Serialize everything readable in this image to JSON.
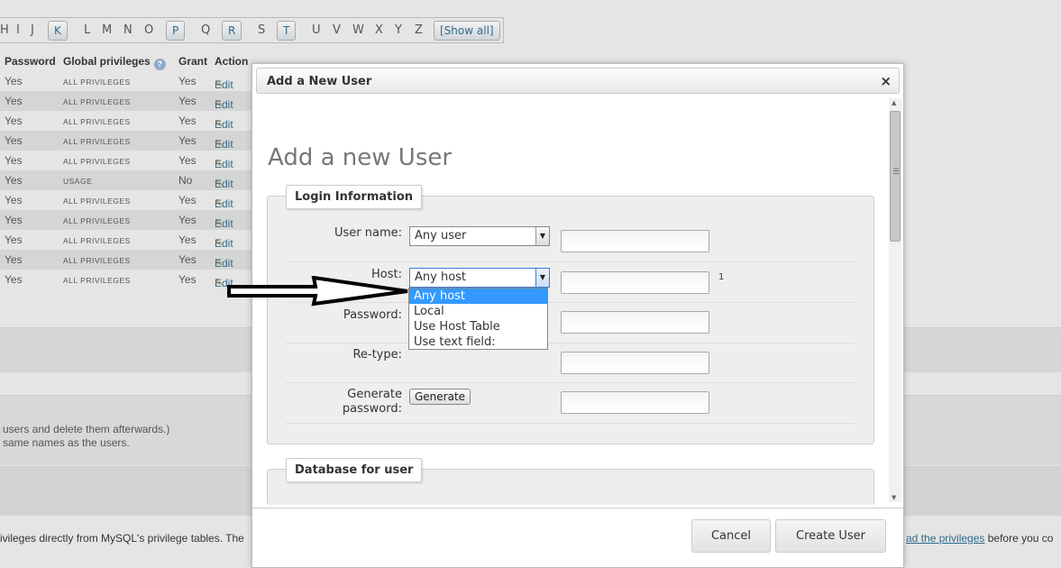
{
  "alphabet": {
    "letters": [
      "H",
      "I",
      "J",
      "K",
      "L",
      "M",
      "N",
      "O",
      "P",
      "Q",
      "R",
      "S",
      "T",
      "U",
      "V",
      "W",
      "X",
      "Y",
      "Z"
    ],
    "show_all": "[Show all]"
  },
  "users_table": {
    "headers": {
      "password": "Password",
      "global_privileges": "Global privileges",
      "grant": "Grant",
      "action": "Action"
    },
    "rows": [
      {
        "password": "Yes",
        "privileges": "ALL PRIVILEGES",
        "grant": "Yes",
        "action": "Edit"
      },
      {
        "password": "Yes",
        "privileges": "ALL PRIVILEGES",
        "grant": "Yes",
        "action": "Edit"
      },
      {
        "password": "Yes",
        "privileges": "ALL PRIVILEGES",
        "grant": "Yes",
        "action": "Edit"
      },
      {
        "password": "Yes",
        "privileges": "ALL PRIVILEGES",
        "grant": "Yes",
        "action": "Edit"
      },
      {
        "password": "Yes",
        "privileges": "ALL PRIVILEGES",
        "grant": "Yes",
        "action": "Edit"
      },
      {
        "password": "Yes",
        "privileges": "USAGE",
        "grant": "No",
        "action": "Edit"
      },
      {
        "password": "Yes",
        "privileges": "ALL PRIVILEGES",
        "grant": "Yes",
        "action": "Edit"
      },
      {
        "password": "Yes",
        "privileges": "ALL PRIVILEGES",
        "grant": "Yes",
        "action": "Edit"
      },
      {
        "password": "Yes",
        "privileges": "ALL PRIVILEGES",
        "grant": "Yes",
        "action": "Edit"
      },
      {
        "password": "Yes",
        "privileges": "ALL PRIVILEGES",
        "grant": "Yes",
        "action": "Edit"
      },
      {
        "password": "Yes",
        "privileges": "ALL PRIVILEGES",
        "grant": "Yes",
        "action": "Edit"
      }
    ]
  },
  "background_notes": {
    "line1": "users and delete them afterwards.)",
    "line2": "same names as the users.",
    "footer_left": "ivileges directly from MySQL's privilege tables. The",
    "footer_link": "ad the privileges",
    "footer_right": "before you co"
  },
  "dialog": {
    "title": "Add a New User",
    "close": "×",
    "heading": "Add a new User",
    "login_legend": "Login Information",
    "db_legend": "Database for user",
    "fields": {
      "username_label": "User name:",
      "username_value": "Any user",
      "host_label": "Host:",
      "host_value": "Any host",
      "host_marker": "1",
      "password_label": "Password:",
      "retype_label": "Re-type:",
      "generate_label_1": "Generate",
      "generate_label_2": "password:",
      "generate_button": "Generate"
    },
    "host_options": [
      "Any host",
      "Local",
      "Use Host Table",
      "Use text field:"
    ],
    "cancel": "Cancel",
    "create": "Create User"
  },
  "colors": {
    "link": "#2f6b8a",
    "selected_option": "#3399ff"
  }
}
